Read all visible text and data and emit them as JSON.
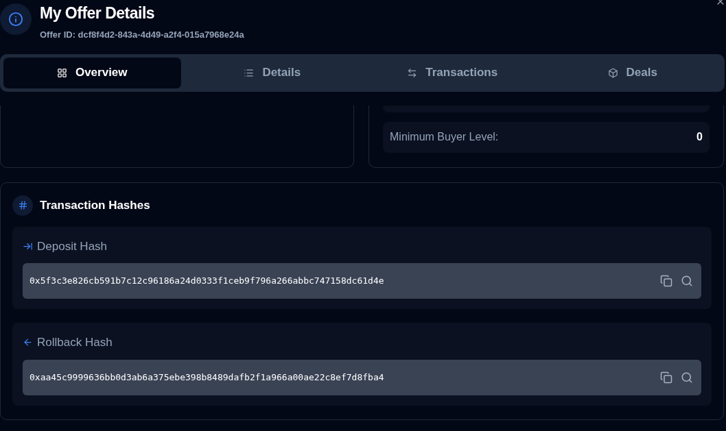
{
  "header": {
    "title": "My Offer Details",
    "subtitle": "Offer ID: dcf8f4d2-843a-4d49-a2f4-015a7968e24a"
  },
  "tabs": [
    {
      "label": "Overview",
      "kind": "grid",
      "selected": true
    },
    {
      "label": "Details",
      "kind": "list",
      "selected": false
    },
    {
      "label": "Transactions",
      "kind": "swap",
      "selected": false
    },
    {
      "label": "Deals",
      "kind": "box",
      "selected": false
    }
  ],
  "offer_terms": [
    {
      "label": "Minimum Buyer Level:",
      "value": "0"
    }
  ],
  "transaction_hashes": {
    "title": "Transaction Hashes",
    "items": [
      {
        "label": "Deposit Hash",
        "kind": "deposit",
        "value": "0x5f3c3e826cb591b7c12c96186a24d0333f1ceb9f796a266abbc747158dc61d4e"
      },
      {
        "label": "Rollback Hash",
        "kind": "rollback",
        "value": "0xaa45c9999636bb0d3ab6a375ebe398b8489dafb2f1a966a00ae22c8ef7d8fba4"
      }
    ]
  }
}
